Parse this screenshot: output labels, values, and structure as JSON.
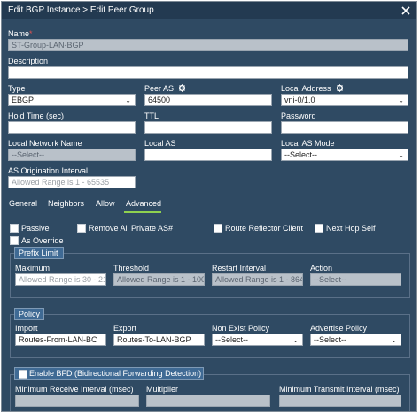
{
  "dialog": {
    "title": "Edit BGP Instance > Edit Peer Group"
  },
  "name": {
    "label": "Name",
    "required_mark": "*",
    "value": "ST-Group-LAN-BGP"
  },
  "description": {
    "label": "Description",
    "value": ""
  },
  "type": {
    "label": "Type",
    "value": "EBGP"
  },
  "peer_as": {
    "label": "Peer AS",
    "value": "64500"
  },
  "local_address": {
    "label": "Local Address",
    "value": "vni-0/1.0"
  },
  "hold_time": {
    "label": "Hold Time (sec)",
    "value": ""
  },
  "ttl": {
    "label": "TTL",
    "value": ""
  },
  "password": {
    "label": "Password",
    "value": ""
  },
  "local_network_name": {
    "label": "Local Network Name",
    "value": "--Select--"
  },
  "local_as": {
    "label": "Local AS",
    "value": ""
  },
  "local_as_mode": {
    "label": "Local AS Mode",
    "value": "--Select--"
  },
  "as_origination_interval": {
    "label": "AS Origination Interval",
    "placeholder": "Allowed Range is 1 - 65535"
  },
  "tabs": [
    {
      "label": "General"
    },
    {
      "label": "Neighbors"
    },
    {
      "label": "Allow"
    },
    {
      "label": "Advanced",
      "active": true
    }
  ],
  "options": {
    "passive": "Passive",
    "remove_private_as": "Remove All Private AS#",
    "route_reflector_client": "Route Reflector Client",
    "next_hop_self": "Next Hop Self",
    "as_override": "As Override"
  },
  "prefix_limit": {
    "title": "Prefix Limit",
    "maximum": {
      "label": "Maximum",
      "placeholder": "Allowed Range is 30 - 21"
    },
    "threshold": {
      "label": "Threshold",
      "placeholder": "Allowed Range is 1 - 100"
    },
    "restart_interval": {
      "label": "Restart Interval",
      "placeholder": "Allowed Range is 1 - 864"
    },
    "action": {
      "label": "Action",
      "value": "--Select--"
    }
  },
  "policy": {
    "title": "Policy",
    "import": {
      "label": "Import",
      "value": "Routes-From-LAN-BC"
    },
    "export": {
      "label": "Export",
      "value": "Routes-To-LAN-BGP"
    },
    "non_exist_policy": {
      "label": "Non Exist Policy",
      "value": "--Select--"
    },
    "advertise_policy": {
      "label": "Advertise Policy",
      "value": "--Select--"
    }
  },
  "bfd": {
    "title": "Enable BFD (Bidirectional Forwarding Detection)",
    "min_receive": {
      "label": "Minimum Receive Interval (msec)"
    },
    "multiplier": {
      "label": "Multiplier"
    },
    "min_transmit": {
      "label": "Minimum Transmit Interval (msec)"
    }
  },
  "colors": {
    "dialog_bg": "#2f4a63",
    "titlebar_bg": "#233a51",
    "tab_accent": "#8fd14f",
    "required": "#e05050"
  }
}
